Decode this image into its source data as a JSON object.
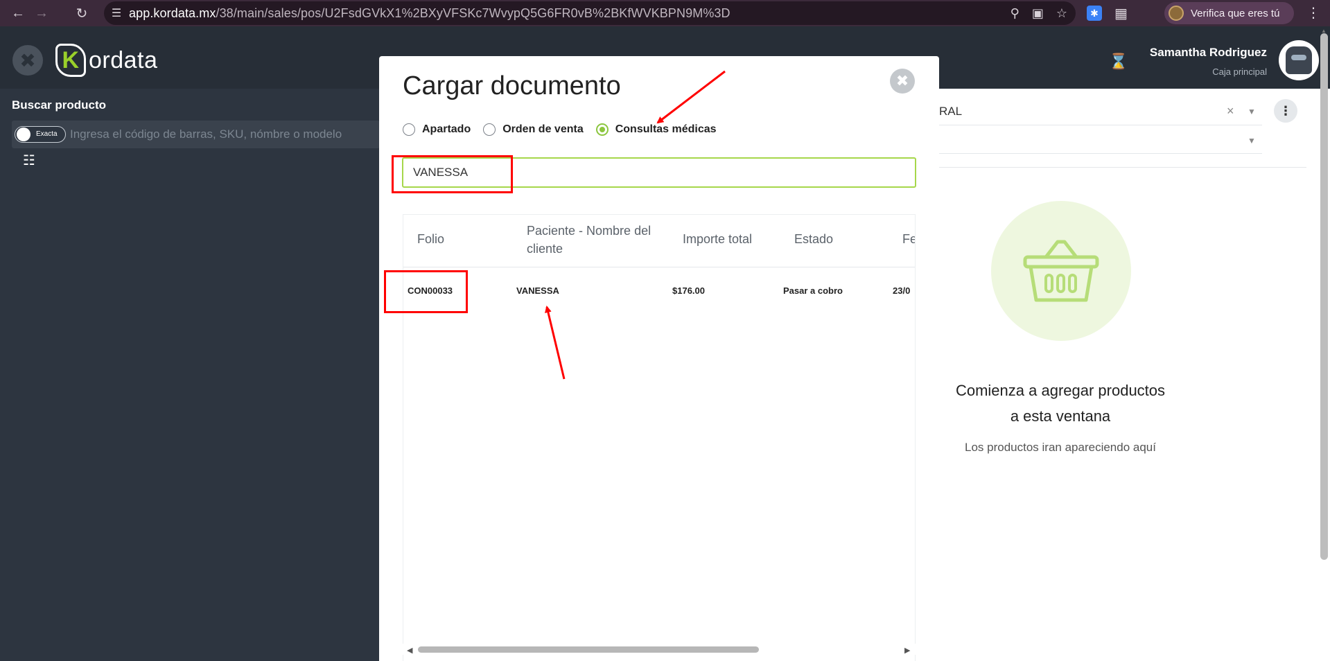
{
  "browser": {
    "url_host": "app.kordata.mx",
    "url_path": "/38/main/sales/pos/U2FsdGVkX1%2BXyVFSKc7WvypQ5G6FR0vB%2BKfWVKBPN9M%3D",
    "profile_label": "Verifica que eres tú"
  },
  "header": {
    "logo_text": "ordata",
    "logo_letter": "K",
    "user_name": "Samantha Rodriguez",
    "user_role": "Caja principal"
  },
  "left": {
    "search_label": "Buscar producto",
    "toggle_label": "Exacta",
    "search_placeholder": "Ingresa el código de barras, SKU, nómbre o modelo"
  },
  "right": {
    "client_value": "RAL",
    "empty_title_line1": "Comienza a agregar productos",
    "empty_title_line2": "a esta ventana",
    "empty_subtitle": "Los productos iran apareciendo aquí"
  },
  "modal": {
    "title": "Cargar documento",
    "radios": [
      {
        "label": "Apartado",
        "selected": false
      },
      {
        "label": "Orden de venta",
        "selected": false
      },
      {
        "label": "Consultas médicas",
        "selected": true
      }
    ],
    "search_value": "VANESSA",
    "columns": [
      "Folio",
      "Paciente - Nombre del cliente",
      "Importe total",
      "Estado",
      "Fe"
    ],
    "rows": [
      {
        "folio": "CON00033",
        "paciente": "VANESSA",
        "importe": "$176.00",
        "estado": "Pasar a cobro",
        "fecha": "23/0"
      }
    ]
  },
  "colors": {
    "accent_green": "#8cc63f",
    "annotation_red": "#ff0000",
    "sidebar_bg": "#2d3540"
  }
}
